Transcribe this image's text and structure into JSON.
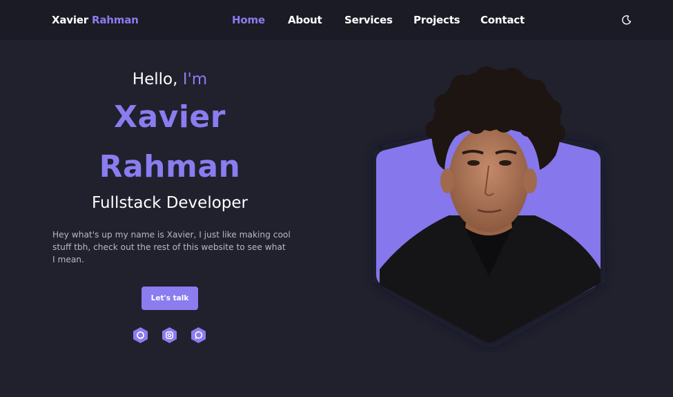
{
  "header": {
    "brand_first": "Xavier",
    "brand_last": "Rahman",
    "nav": [
      {
        "label": "Home",
        "active": true
      },
      {
        "label": "About",
        "active": false
      },
      {
        "label": "Services",
        "active": false
      },
      {
        "label": "Projects",
        "active": false
      },
      {
        "label": "Contact",
        "active": false
      }
    ],
    "theme_icon": "moon-icon"
  },
  "hero": {
    "greeting_prefix": "Hello, ",
    "greeting_accent": "I'm",
    "name_first": "Xavier",
    "name_last": "Rahman",
    "role": "Fullstack Developer",
    "bio": "Hey what's up my name is Xavier, I just like making cool stuff tbh, check out the rest of this website to see what I mean.",
    "cta_label": "Let's talk",
    "socials": [
      {
        "icon": "github-icon"
      },
      {
        "icon": "instagram-icon"
      },
      {
        "icon": "whatsapp-icon"
      }
    ]
  },
  "colors": {
    "accent": "#8b7cf0",
    "background": "#20212d",
    "header_background": "#1a1b24"
  }
}
